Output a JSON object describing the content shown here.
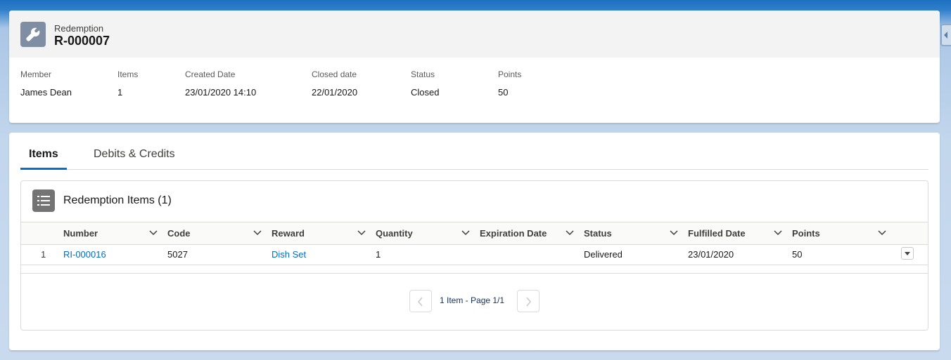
{
  "header": {
    "object_type": "Redemption",
    "record_name": "R-000007",
    "fields": [
      {
        "label": "Member",
        "value": "James Dean"
      },
      {
        "label": "Items",
        "value": "1"
      },
      {
        "label": "Created Date",
        "value": "23/01/2020 14:10"
      },
      {
        "label": "Closed date",
        "value": "22/01/2020"
      },
      {
        "label": "Status",
        "value": "Closed"
      },
      {
        "label": "Points",
        "value": "50"
      }
    ]
  },
  "tabs": [
    {
      "label": "Items",
      "active": true
    },
    {
      "label": "Debits & Credits",
      "active": false
    }
  ],
  "related_list": {
    "title": "Redemption Items (1)",
    "columns": [
      "Number",
      "Code",
      "Reward",
      "Quantity",
      "Expiration Date",
      "Status",
      "Fulfilled Date",
      "Points"
    ],
    "rows": [
      {
        "row_number": "1",
        "number": "RI-000016",
        "code": "5027",
        "reward": "Dish Set",
        "quantity": "1",
        "expiration_date": "",
        "status": "Delivered",
        "fulfilled_date": "23/01/2020",
        "points": "50"
      }
    ],
    "pager_text": "1 Item - Page 1/1"
  },
  "icons": {
    "object": "wrench-icon",
    "related": "list-icon",
    "sort": "chevron-down-icon",
    "row_action": "dropdown-icon",
    "prev": "chevron-left-icon",
    "next": "chevron-right-icon"
  },
  "colors": {
    "brand": "#0070d2",
    "link": "#006dcc",
    "object_icon_bg": "#7f8ea3",
    "related_icon_bg": "#747474"
  }
}
